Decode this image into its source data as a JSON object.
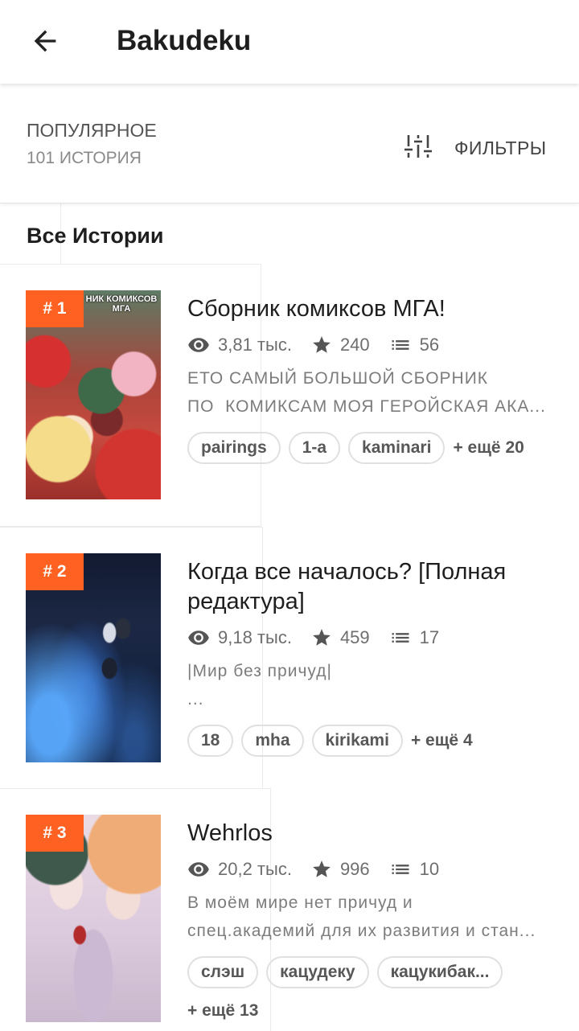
{
  "app_bar": {
    "title": "Bakudeku",
    "back_icon": "arrow-left-icon"
  },
  "sort": {
    "label": "ПОПУЛЯРНОЕ",
    "count": "101 ИСТОРИЯ"
  },
  "filters": {
    "label": "ФИЛЬТРЫ",
    "icon": "sliders-icon"
  },
  "section_heading": "Все Истории",
  "stat_icons": {
    "reads": "eye-icon",
    "votes": "star-icon",
    "parts": "list-icon"
  },
  "colors": {
    "accent": "#FF6122",
    "title_text": "#1E1E1E",
    "muted_text": "#7C7C7C",
    "pill_border": "#E0E0E0"
  },
  "stories": [
    {
      "rank": "# 1",
      "cover_text": [
        "НИК КОМИКСОВ",
        "МГА"
      ],
      "title": "Сборник комиксов МГА!",
      "reads": "3,81 тыс.",
      "votes": "240",
      "parts": "56",
      "description": [
        "ЕТО САМЫЙ БОЛЬШОЙ СБОРНИК",
        "ПО  КОМИКСАМ МОЯ ГЕРОЙСКАЯ АКА..."
      ],
      "tags": [
        "pairings",
        "1-a",
        "kaminari"
      ],
      "more_tags": "+ ещё 20"
    },
    {
      "rank": "# 2",
      "title": "Когда все началось? [Полная редактура]",
      "reads": "9,18 тыс.",
      "votes": "459",
      "parts": "17",
      "description": [
        "|Мир без причуд|",
        "..."
      ],
      "tags": [
        "18",
        "mha",
        "kirikami"
      ],
      "more_tags": "+ ещё 4"
    },
    {
      "rank": "# 3",
      "title": "Wehrlos",
      "reads": "20,2 тыс.",
      "votes": "996",
      "parts": "10",
      "description": [
        "В моём мире нет причуд и",
        "спец.академий для их развития и стан..."
      ],
      "tags": [
        "слэш",
        "кацудеку",
        "кацукибак..."
      ],
      "more_tags": "+ ещё 13"
    }
  ]
}
